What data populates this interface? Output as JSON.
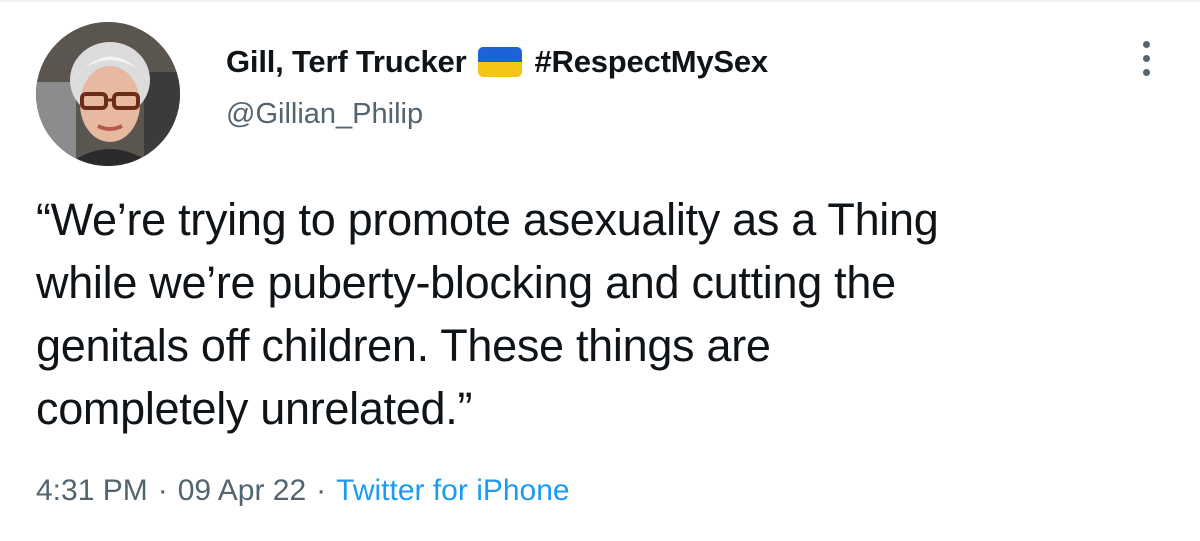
{
  "author": {
    "display_name": "Gill, Terf Trucker",
    "flag_icon": "ukraine-flag-icon",
    "flag_colors": [
      "#1d63d8",
      "#f5c518"
    ],
    "hashtag": "#RespectMySex",
    "handle": "@Gillian_Philip"
  },
  "tweet": {
    "lines": [
      "“We’re trying to promote asexuality as a Thing",
      "while we’re puberty-blocking and cutting the",
      "genitals off children. These things are",
      "completely unrelated.”"
    ]
  },
  "meta": {
    "time": "4:31 PM",
    "separator": "·",
    "date": "09 Apr 22",
    "source": "Twitter for iPhone"
  },
  "colors": {
    "text": "#0f1419",
    "secondary": "#536471",
    "link": "#1d9bf0"
  },
  "icons": {
    "more": "more-dots-vertical-icon",
    "avatar": "profile-photo"
  }
}
